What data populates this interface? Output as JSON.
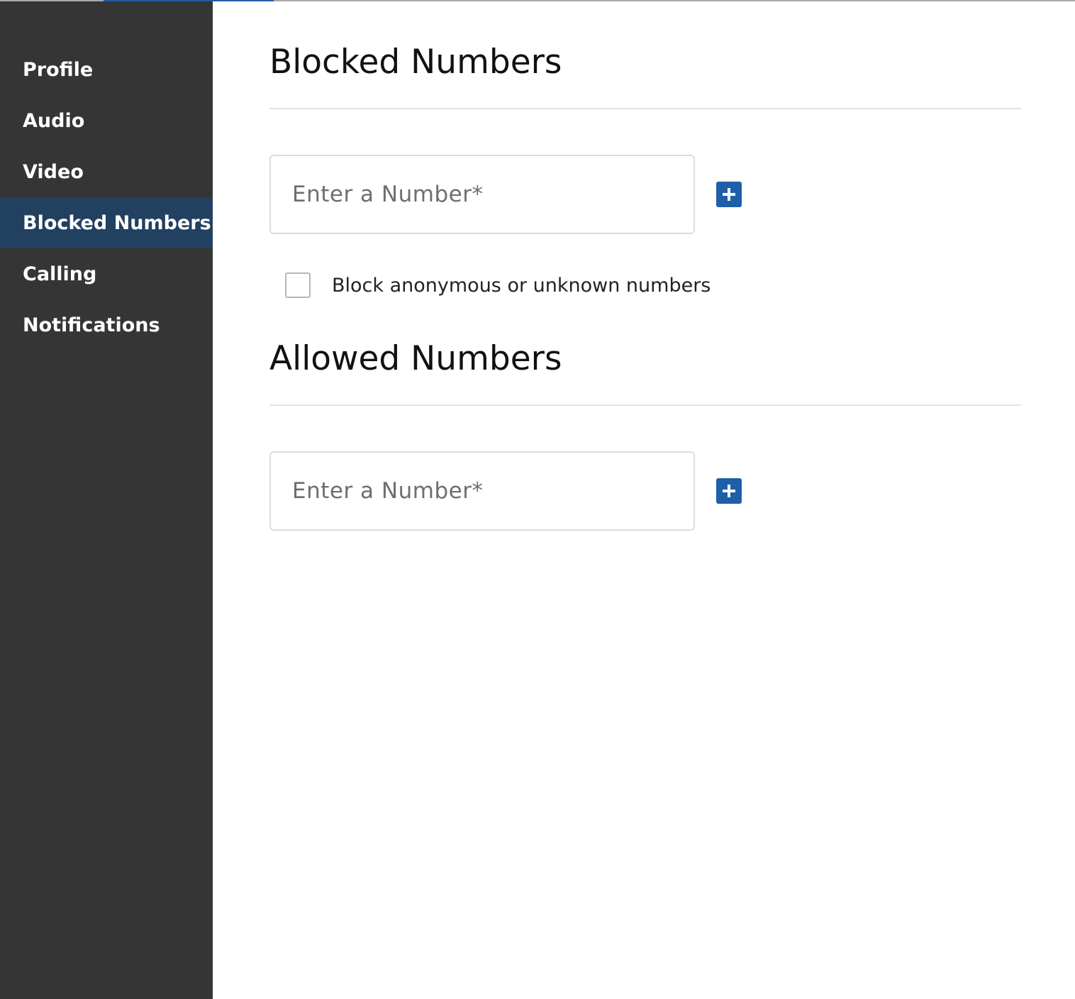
{
  "colors": {
    "sidebar_bg": "#353535",
    "sidebar_active_bg": "#22405f",
    "accent": "#1f5fa8"
  },
  "sidebar": {
    "items": [
      {
        "label": "Profile",
        "active": false
      },
      {
        "label": "Audio",
        "active": false
      },
      {
        "label": "Video",
        "active": false
      },
      {
        "label": "Blocked Numbers",
        "active": true
      },
      {
        "label": "Calling",
        "active": false
      },
      {
        "label": "Notifications",
        "active": false
      }
    ]
  },
  "blocked": {
    "title": "Blocked Numbers",
    "input": {
      "placeholder": "Enter a Number*",
      "value": ""
    },
    "add_icon": "plus-icon",
    "anonymous_checkbox": {
      "label": "Block anonymous or unknown numbers",
      "checked": false
    }
  },
  "allowed": {
    "title": "Allowed Numbers",
    "input": {
      "placeholder": "Enter a Number*",
      "value": ""
    },
    "add_icon": "plus-icon"
  }
}
